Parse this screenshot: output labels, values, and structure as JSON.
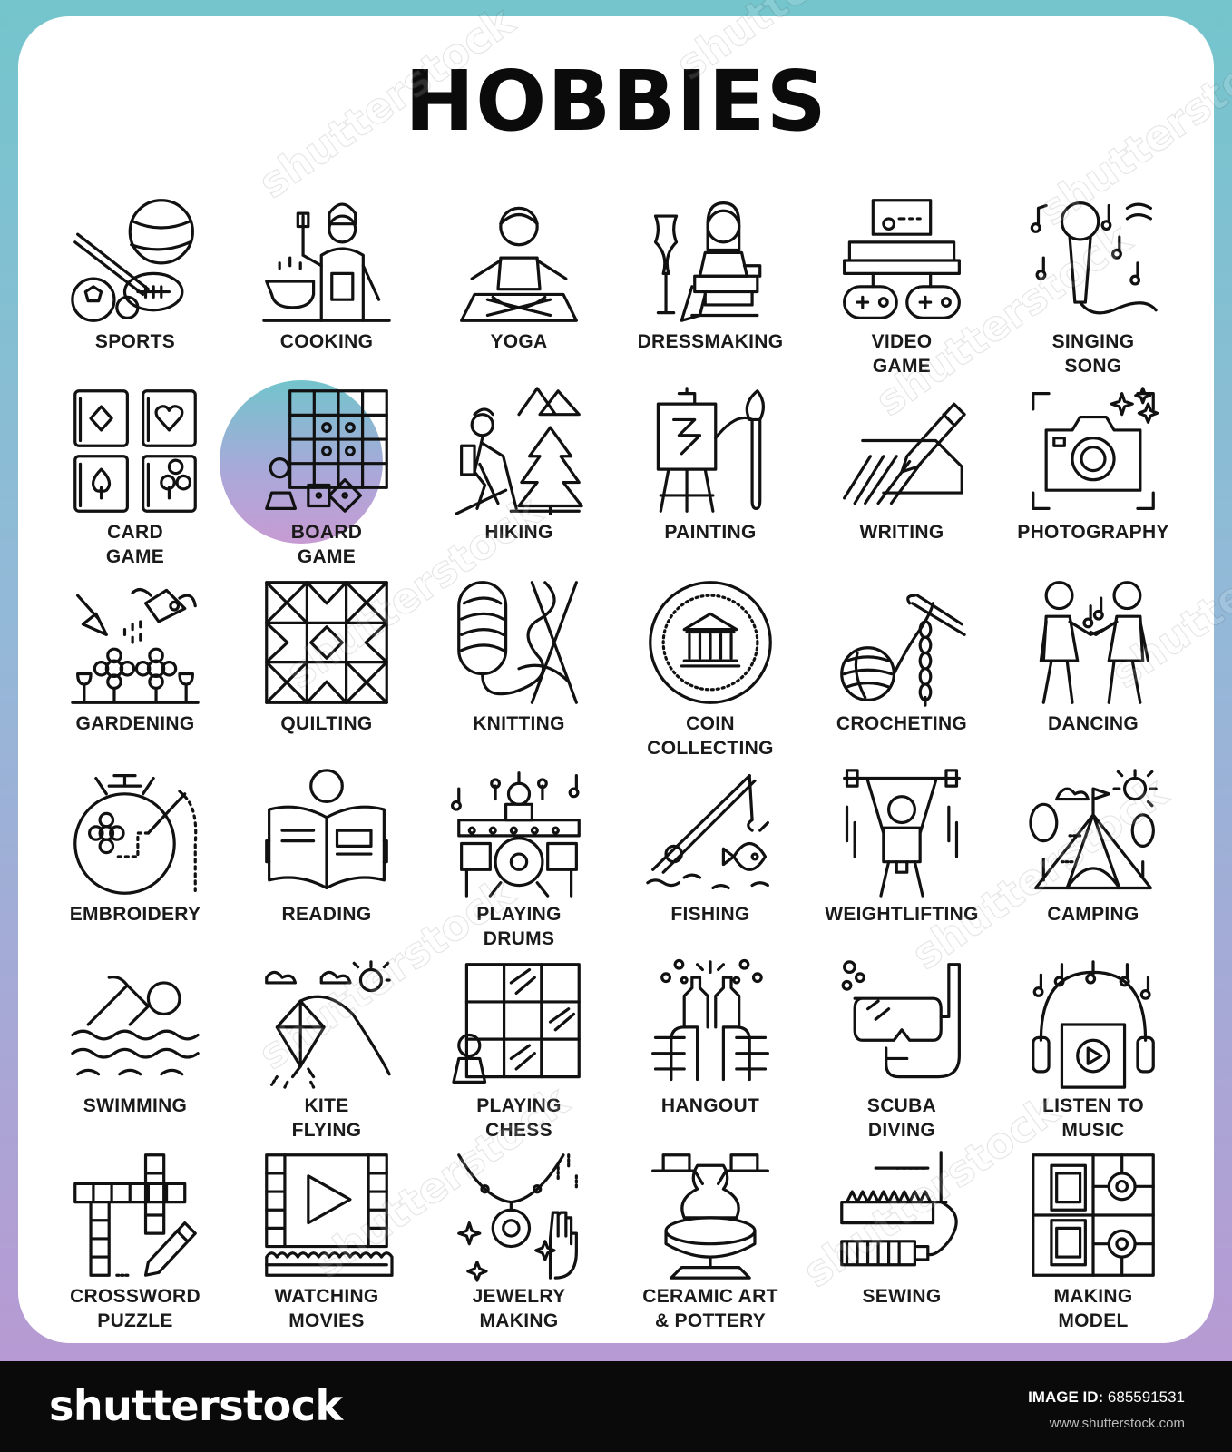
{
  "title": "HOBBIES",
  "icons": [
    {
      "id": "sports",
      "lines": [
        "SPORTS"
      ]
    },
    {
      "id": "cooking",
      "lines": [
        "COOKING"
      ]
    },
    {
      "id": "yoga",
      "lines": [
        "YOGA"
      ]
    },
    {
      "id": "dressmaking",
      "lines": [
        "DRESSMAKING"
      ]
    },
    {
      "id": "video-game",
      "lines": [
        "VIDEO",
        "GAME"
      ]
    },
    {
      "id": "singing-song",
      "lines": [
        "SINGING",
        "SONG"
      ]
    },
    {
      "id": "card-game",
      "lines": [
        "CARD",
        "GAME"
      ]
    },
    {
      "id": "board-game",
      "lines": [
        "BOARD",
        "GAME"
      ],
      "highlighted": true
    },
    {
      "id": "hiking",
      "lines": [
        "HIKING"
      ]
    },
    {
      "id": "painting",
      "lines": [
        "PAINTING"
      ]
    },
    {
      "id": "writing",
      "lines": [
        "WRITING"
      ]
    },
    {
      "id": "photography",
      "lines": [
        "PHOTOGRAPHY"
      ]
    },
    {
      "id": "gardening",
      "lines": [
        "GARDENING"
      ]
    },
    {
      "id": "quilting",
      "lines": [
        "QUILTING"
      ]
    },
    {
      "id": "knitting",
      "lines": [
        "KNITTING"
      ]
    },
    {
      "id": "coin-collecting",
      "lines": [
        "COIN",
        "COLLECTING"
      ]
    },
    {
      "id": "crocheting",
      "lines": [
        "CROCHETING"
      ]
    },
    {
      "id": "dancing",
      "lines": [
        "DANCING"
      ]
    },
    {
      "id": "embroidery",
      "lines": [
        "EMBROIDERY"
      ]
    },
    {
      "id": "reading",
      "lines": [
        "READING"
      ]
    },
    {
      "id": "playing-drums",
      "lines": [
        "PLAYING",
        "DRUMS"
      ]
    },
    {
      "id": "fishing",
      "lines": [
        "FISHING"
      ]
    },
    {
      "id": "weightlifting",
      "lines": [
        "WEIGHTLIFTING"
      ]
    },
    {
      "id": "camping",
      "lines": [
        "CAMPING"
      ]
    },
    {
      "id": "swimming",
      "lines": [
        "SWIMMING"
      ]
    },
    {
      "id": "kite-flying",
      "lines": [
        "KITE",
        "FLYING"
      ]
    },
    {
      "id": "playing-chess",
      "lines": [
        "PLAYING",
        "CHESS"
      ]
    },
    {
      "id": "hangout",
      "lines": [
        "HANGOUT"
      ]
    },
    {
      "id": "scuba-diving",
      "lines": [
        "SCUBA",
        "DIVING"
      ]
    },
    {
      "id": "listen-to-music",
      "lines": [
        "LISTEN TO",
        "MUSIC"
      ]
    },
    {
      "id": "crossword-puzzle",
      "lines": [
        "CROSSWORD",
        "PUZZLE"
      ]
    },
    {
      "id": "watching-movies",
      "lines": [
        "WATCHING",
        "MOVIES"
      ]
    },
    {
      "id": "jewelry-making",
      "lines": [
        "JEWELRY",
        "MAKING"
      ]
    },
    {
      "id": "ceramic-art-pottery",
      "lines": [
        "CERAMIC ART",
        "& POTTERY"
      ]
    },
    {
      "id": "sewing",
      "lines": [
        "SEWING"
      ]
    },
    {
      "id": "making-model",
      "lines": [
        "MAKING",
        "MODEL"
      ]
    }
  ],
  "watermark": "shutterstock",
  "footer": {
    "logo": "shutterstock",
    "image_id_label": "IMAGE ID:",
    "image_id": "685591531",
    "url": "www.shutterstock.com"
  },
  "colors": {
    "frame_top": "#74c5cc",
    "frame_bottom": "#b79ad3",
    "highlight_circle": "#a8a9d9",
    "line": "#111111",
    "footer_bg": "#0a0a0a"
  }
}
